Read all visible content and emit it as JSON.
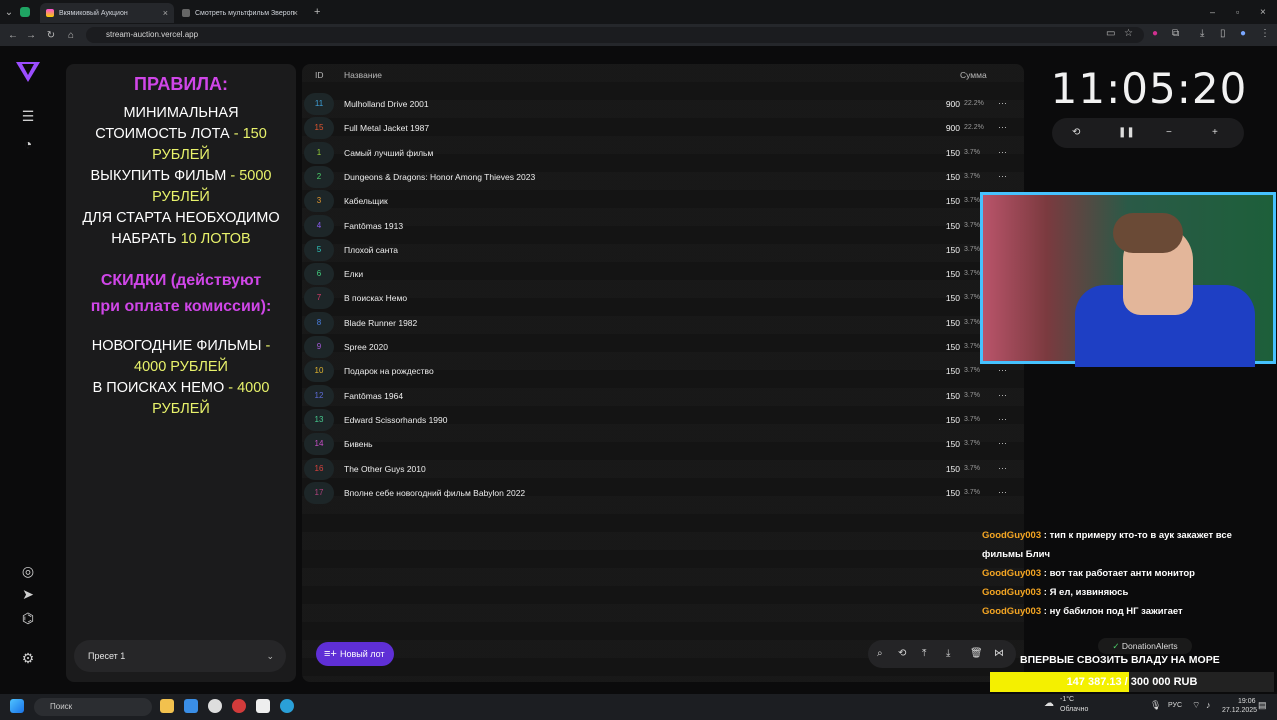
{
  "browser": {
    "tabs": [
      {
        "title": "Вкямиковый Аукцион",
        "active": true
      },
      {
        "title": "Смотреть мультфильм Зверопо...",
        "active": false
      }
    ],
    "url": "stream-auction.vercel.app"
  },
  "rules": {
    "heading": "ПРАВИЛА:",
    "line1a": "МИНИМАЛЬНАЯ СТОИМОСТЬ ЛОТА",
    "line1b": " - 150 РУБЛЕЙ",
    "line2a": "ВЫКУПИТЬ ФИЛЬМ",
    "line2b": " - 5000 РУБЛЕЙ",
    "line3a": "ДЛЯ СТАРТА НЕОБХОДИМО НАБРАТЬ ",
    "line3b": "10 ЛОТОВ",
    "discounts_heading": "СКИДКИ (действуют при оплате комиссии):",
    "line4a": "НОВОГОДНИЕ ФИЛЬМЫ",
    "line4b": " - 4000 РУБЛЕЙ",
    "line5a": "В ПОИСКАХ НЕМО",
    "line5b": " - 4000 РУБЛЕЙ"
  },
  "preset": {
    "label": "Пресет 1"
  },
  "table": {
    "headers": {
      "id": "ID",
      "name": "Название",
      "sum": "Сумма"
    },
    "rows": [
      {
        "id": "11",
        "name": "Mulholland Drive 2001",
        "amount": "900",
        "pct": "22.2%",
        "color": "#3fa0d8"
      },
      {
        "id": "15",
        "name": "Full Metal Jacket 1987",
        "amount": "900",
        "pct": "22.2%",
        "color": "#e0552f"
      },
      {
        "id": "1",
        "name": "Самый лучший фильм",
        "amount": "150",
        "pct": "3.7%",
        "color": "#9bd13a"
      },
      {
        "id": "2",
        "name": "Dungeons & Dragons: Honor Among Thieves 2023",
        "amount": "150",
        "pct": "3.7%",
        "color": "#4ccf6a"
      },
      {
        "id": "3",
        "name": "Кабельщик",
        "amount": "150",
        "pct": "3.7%",
        "color": "#e0962f"
      },
      {
        "id": "4",
        "name": "Fantômas 1913",
        "amount": "150",
        "pct": "3.7%",
        "color": "#8a5cf0"
      },
      {
        "id": "5",
        "name": "Плохой санта",
        "amount": "150",
        "pct": "3.7%",
        "color": "#2fc9c0"
      },
      {
        "id": "6",
        "name": "Елки",
        "amount": "150",
        "pct": "3.7%",
        "color": "#43d07f"
      },
      {
        "id": "7",
        "name": "В поисках Немо",
        "amount": "150",
        "pct": "3.7%",
        "color": "#d83e6b"
      },
      {
        "id": "8",
        "name": "Blade Runner 1982",
        "amount": "150",
        "pct": "3.7%",
        "color": "#4a7fe0"
      },
      {
        "id": "9",
        "name": "Spree 2020",
        "amount": "150",
        "pct": "3.7%",
        "color": "#a45ad8"
      },
      {
        "id": "10",
        "name": "Подарок на рождество",
        "amount": "150",
        "pct": "3.7%",
        "color": "#e0b32f"
      },
      {
        "id": "12",
        "name": "Fantômas 1964",
        "amount": "150",
        "pct": "3.7%",
        "color": "#5d6bd8"
      },
      {
        "id": "13",
        "name": "Edward Scissorhands 1990",
        "amount": "150",
        "pct": "3.7%",
        "color": "#47c98f"
      },
      {
        "id": "14",
        "name": "Бивень",
        "amount": "150",
        "pct": "3.7%",
        "color": "#c94fc8"
      },
      {
        "id": "16",
        "name": "The Other Guys 2010",
        "amount": "150",
        "pct": "3.7%",
        "color": "#d8423e"
      },
      {
        "id": "17",
        "name": "Вполне себе новогодний фильм Babylon 2022",
        "amount": "150",
        "pct": "3.7%",
        "color": "#b0427e"
      }
    ]
  },
  "new_lot_button": "Новый лот",
  "timer": {
    "hh": "11",
    "mm": "05",
    "ss": "20"
  },
  "chat": [
    {
      "user": "GoodGuy003",
      "text": "тип к примеру кто-то в аук закажет все фильмы Блич"
    },
    {
      "user": "GoodGuy003",
      "text": "вот так работает анти монитор"
    },
    {
      "user": "GoodGuy003",
      "text": "Я ел, извиняюсь"
    },
    {
      "user": "GoodGuy003",
      "text": "ну бабилон под НГ зажигает"
    }
  ],
  "donation": {
    "brand": "DonationAlerts",
    "goal_title": "ВПЕРВЫЕ СВОЗИТЬ ВЛАДУ НА МОРЕ",
    "goal_progress_text": "147 387.13 / 300 000 RUB",
    "goal_fraction": 0.491,
    "fill_color": "#f4f000"
  },
  "taskbar": {
    "search_placeholder": "Поиск",
    "weather_temp": "-1°C",
    "weather_text": "Облачно",
    "lang": "РУС",
    "time": "19:06",
    "date": "27.12.2025"
  }
}
